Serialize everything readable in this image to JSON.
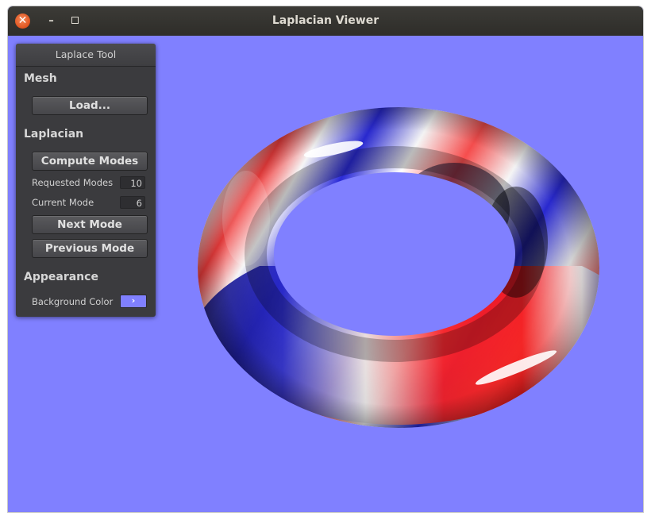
{
  "window": {
    "title": "Laplacian Viewer",
    "close_glyph": "✕",
    "minimize_glyph": "–"
  },
  "panel": {
    "title": "Laplace Tool",
    "sections": {
      "mesh": "Mesh",
      "laplacian": "Laplacian",
      "appearance": "Appearance"
    },
    "buttons": {
      "load": "Load...",
      "compute_modes": "Compute Modes",
      "next_mode": "Next Mode",
      "previous_mode": "Previous Mode"
    },
    "fields": {
      "requested_modes_label": "Requested Modes",
      "requested_modes_value": "10",
      "current_mode_label": "Current Mode",
      "current_mode_value": "6",
      "background_color_label": "Background Color",
      "background_color_glyph": "›"
    }
  },
  "colors": {
    "background": "#8080ff",
    "mode_positive": "#ff2020",
    "mode_negative": "#2020d0",
    "mode_zero": "#ffffff"
  },
  "icons": {
    "close": "close-icon",
    "minimize": "minimize-icon",
    "maximize": "maximize-icon",
    "color_picker": "chevron-right-icon"
  },
  "viewport": {
    "object": "torus",
    "shading": "eigenmode-colormap"
  }
}
